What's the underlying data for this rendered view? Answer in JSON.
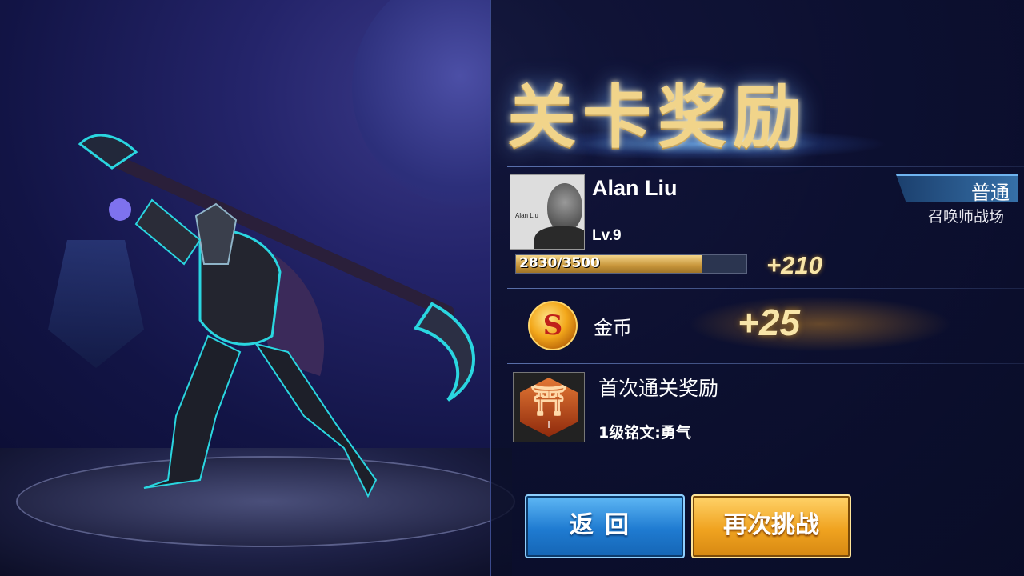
{
  "title": "关卡奖励",
  "player": {
    "name": "Alan Liu",
    "level": "Lv.9",
    "avatar_caption": "Alan Liu",
    "xp_text": "2830/3500",
    "xp_fraction": 0.8086,
    "xp_gain": "+210"
  },
  "mode": {
    "label": "普通",
    "subtitle": "召唤师战场"
  },
  "gold": {
    "label": "金币",
    "gain": "+25",
    "icon": "gold-coin-icon",
    "icon_glyph": "S"
  },
  "first_clear": {
    "title": "首次通关奖励",
    "reward": "1级铭文:勇气",
    "rune_icon": "rune-courage-icon",
    "rune_numeral": "I"
  },
  "buttons": {
    "back": "返回",
    "retry": "再次挑战"
  },
  "colors": {
    "accent_gold": "#f1d48a",
    "button_blue": "#1f7bd1",
    "button_orange": "#f0a320"
  }
}
